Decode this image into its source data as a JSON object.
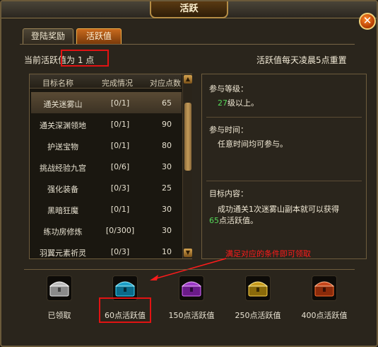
{
  "window": {
    "title": "活跃",
    "close_label": "✕"
  },
  "tabs": [
    {
      "label": "登陆奖励",
      "active": false
    },
    {
      "label": "活跃值",
      "active": true
    }
  ],
  "current_points": {
    "label": "当前活跃值为 1 点"
  },
  "reset_note": "活跃值每天凌晨5点重置",
  "table": {
    "headers": [
      "目标名称",
      "完成情况",
      "对应点数"
    ],
    "rows": [
      {
        "name": "通关迷雾山",
        "progress": "[0/1]",
        "points": "65",
        "selected": true
      },
      {
        "name": "通关深渊领地",
        "progress": "[0/1]",
        "points": "90"
      },
      {
        "name": "护送宝物",
        "progress": "[0/1]",
        "points": "80"
      },
      {
        "name": "挑战经验九宫",
        "progress": "[0/6]",
        "points": "30"
      },
      {
        "name": "强化装备",
        "progress": "[0/3]",
        "points": "25"
      },
      {
        "name": "黑暗狂魔",
        "progress": "[0/1]",
        "points": "30"
      },
      {
        "name": "练功房修炼",
        "progress": "[0/300]",
        "points": "30"
      },
      {
        "name": "羽翼元素祈灵",
        "progress": "[0/3]",
        "points": "10"
      }
    ]
  },
  "info": {
    "level_label": "参与等级：",
    "level_value": "27",
    "level_suffix": "级以上。",
    "time_label": "参与时间：",
    "time_value": "任意时间均可参与。",
    "goal_label": "目标内容：",
    "goal_line1": "成功通关1次迷雾山副本就可以获得",
    "goal_value": "65",
    "goal_line2": "点活跃值。"
  },
  "annotation": "满足对应的条件即可领取",
  "rewards": [
    {
      "label": "已领取",
      "color": "#d0d0d0"
    },
    {
      "label": "60点活跃值",
      "color": "#39d7ff"
    },
    {
      "label": "150点活跃值",
      "color": "#d86bff"
    },
    {
      "label": "250点活跃值",
      "color": "#ffd24a"
    },
    {
      "label": "400点活跃值",
      "color": "#ff6a2a"
    }
  ]
}
